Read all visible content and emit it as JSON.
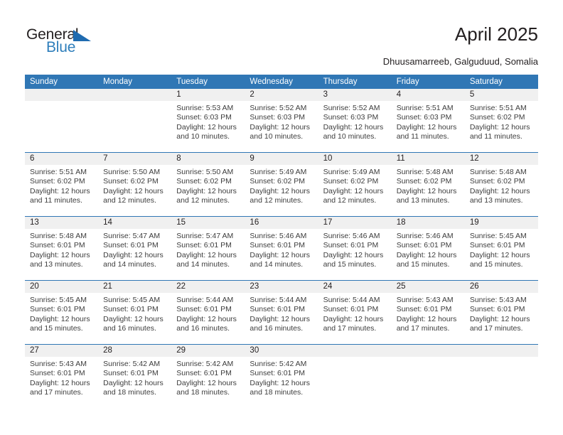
{
  "logo": {
    "word1": "General",
    "word2": "Blue",
    "triangle_color": "#1f6bb0",
    "word2_color": "#2e7ebb"
  },
  "header": {
    "title": "April 2025",
    "subtitle": "Dhuusamarreeb, Galguduud, Somalia"
  },
  "theme": {
    "accent": "#3077b5",
    "band": "#f0f0f0",
    "text": "#231f20",
    "detail_text": "#3d3d3d"
  },
  "calendar": {
    "weekdays": [
      "Sunday",
      "Monday",
      "Tuesday",
      "Wednesday",
      "Thursday",
      "Friday",
      "Saturday"
    ],
    "weeks": [
      [
        {
          "day": "",
          "lines": []
        },
        {
          "day": "",
          "lines": []
        },
        {
          "day": "1",
          "lines": [
            "Sunrise: 5:53 AM",
            "Sunset: 6:03 PM",
            "Daylight: 12 hours",
            "and 10 minutes."
          ]
        },
        {
          "day": "2",
          "lines": [
            "Sunrise: 5:52 AM",
            "Sunset: 6:03 PM",
            "Daylight: 12 hours",
            "and 10 minutes."
          ]
        },
        {
          "day": "3",
          "lines": [
            "Sunrise: 5:52 AM",
            "Sunset: 6:03 PM",
            "Daylight: 12 hours",
            "and 10 minutes."
          ]
        },
        {
          "day": "4",
          "lines": [
            "Sunrise: 5:51 AM",
            "Sunset: 6:03 PM",
            "Daylight: 12 hours",
            "and 11 minutes."
          ]
        },
        {
          "day": "5",
          "lines": [
            "Sunrise: 5:51 AM",
            "Sunset: 6:02 PM",
            "Daylight: 12 hours",
            "and 11 minutes."
          ]
        }
      ],
      [
        {
          "day": "6",
          "lines": [
            "Sunrise: 5:51 AM",
            "Sunset: 6:02 PM",
            "Daylight: 12 hours",
            "and 11 minutes."
          ]
        },
        {
          "day": "7",
          "lines": [
            "Sunrise: 5:50 AM",
            "Sunset: 6:02 PM",
            "Daylight: 12 hours",
            "and 12 minutes."
          ]
        },
        {
          "day": "8",
          "lines": [
            "Sunrise: 5:50 AM",
            "Sunset: 6:02 PM",
            "Daylight: 12 hours",
            "and 12 minutes."
          ]
        },
        {
          "day": "9",
          "lines": [
            "Sunrise: 5:49 AM",
            "Sunset: 6:02 PM",
            "Daylight: 12 hours",
            "and 12 minutes."
          ]
        },
        {
          "day": "10",
          "lines": [
            "Sunrise: 5:49 AM",
            "Sunset: 6:02 PM",
            "Daylight: 12 hours",
            "and 12 minutes."
          ]
        },
        {
          "day": "11",
          "lines": [
            "Sunrise: 5:48 AM",
            "Sunset: 6:02 PM",
            "Daylight: 12 hours",
            "and 13 minutes."
          ]
        },
        {
          "day": "12",
          "lines": [
            "Sunrise: 5:48 AM",
            "Sunset: 6:02 PM",
            "Daylight: 12 hours",
            "and 13 minutes."
          ]
        }
      ],
      [
        {
          "day": "13",
          "lines": [
            "Sunrise: 5:48 AM",
            "Sunset: 6:01 PM",
            "Daylight: 12 hours",
            "and 13 minutes."
          ]
        },
        {
          "day": "14",
          "lines": [
            "Sunrise: 5:47 AM",
            "Sunset: 6:01 PM",
            "Daylight: 12 hours",
            "and 14 minutes."
          ]
        },
        {
          "day": "15",
          "lines": [
            "Sunrise: 5:47 AM",
            "Sunset: 6:01 PM",
            "Daylight: 12 hours",
            "and 14 minutes."
          ]
        },
        {
          "day": "16",
          "lines": [
            "Sunrise: 5:46 AM",
            "Sunset: 6:01 PM",
            "Daylight: 12 hours",
            "and 14 minutes."
          ]
        },
        {
          "day": "17",
          "lines": [
            "Sunrise: 5:46 AM",
            "Sunset: 6:01 PM",
            "Daylight: 12 hours",
            "and 15 minutes."
          ]
        },
        {
          "day": "18",
          "lines": [
            "Sunrise: 5:46 AM",
            "Sunset: 6:01 PM",
            "Daylight: 12 hours",
            "and 15 minutes."
          ]
        },
        {
          "day": "19",
          "lines": [
            "Sunrise: 5:45 AM",
            "Sunset: 6:01 PM",
            "Daylight: 12 hours",
            "and 15 minutes."
          ]
        }
      ],
      [
        {
          "day": "20",
          "lines": [
            "Sunrise: 5:45 AM",
            "Sunset: 6:01 PM",
            "Daylight: 12 hours",
            "and 15 minutes."
          ]
        },
        {
          "day": "21",
          "lines": [
            "Sunrise: 5:45 AM",
            "Sunset: 6:01 PM",
            "Daylight: 12 hours",
            "and 16 minutes."
          ]
        },
        {
          "day": "22",
          "lines": [
            "Sunrise: 5:44 AM",
            "Sunset: 6:01 PM",
            "Daylight: 12 hours",
            "and 16 minutes."
          ]
        },
        {
          "day": "23",
          "lines": [
            "Sunrise: 5:44 AM",
            "Sunset: 6:01 PM",
            "Daylight: 12 hours",
            "and 16 minutes."
          ]
        },
        {
          "day": "24",
          "lines": [
            "Sunrise: 5:44 AM",
            "Sunset: 6:01 PM",
            "Daylight: 12 hours",
            "and 17 minutes."
          ]
        },
        {
          "day": "25",
          "lines": [
            "Sunrise: 5:43 AM",
            "Sunset: 6:01 PM",
            "Daylight: 12 hours",
            "and 17 minutes."
          ]
        },
        {
          "day": "26",
          "lines": [
            "Sunrise: 5:43 AM",
            "Sunset: 6:01 PM",
            "Daylight: 12 hours",
            "and 17 minutes."
          ]
        }
      ],
      [
        {
          "day": "27",
          "lines": [
            "Sunrise: 5:43 AM",
            "Sunset: 6:01 PM",
            "Daylight: 12 hours",
            "and 17 minutes."
          ]
        },
        {
          "day": "28",
          "lines": [
            "Sunrise: 5:42 AM",
            "Sunset: 6:01 PM",
            "Daylight: 12 hours",
            "and 18 minutes."
          ]
        },
        {
          "day": "29",
          "lines": [
            "Sunrise: 5:42 AM",
            "Sunset: 6:01 PM",
            "Daylight: 12 hours",
            "and 18 minutes."
          ]
        },
        {
          "day": "30",
          "lines": [
            "Sunrise: 5:42 AM",
            "Sunset: 6:01 PM",
            "Daylight: 12 hours",
            "and 18 minutes."
          ]
        },
        {
          "day": "",
          "lines": []
        },
        {
          "day": "",
          "lines": []
        },
        {
          "day": "",
          "lines": []
        }
      ]
    ]
  }
}
